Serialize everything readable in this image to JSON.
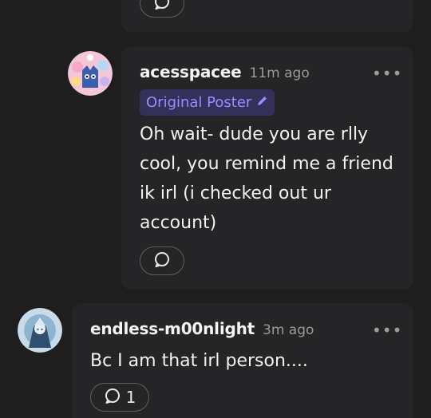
{
  "comments": [
    {
      "username": "acesspacee",
      "time": "11m ago",
      "badge": "Original Poster",
      "body": "Oh wait- dude you are rlly cool, you remind me a friend ik irl (i checked out ur account)",
      "more": "•••"
    },
    {
      "username": "endless-m00nlight",
      "time": "3m ago",
      "body": "Bc I am that irl person....",
      "more": "•••",
      "reply_count": "1"
    }
  ],
  "icons": {
    "reply": "speech-bubble-icon",
    "more": "more-options-icon",
    "pencil": "pencil-icon"
  },
  "colors": {
    "background": "#1e1e1f",
    "card": "#252527",
    "badge_bg": "#33305a",
    "badge_text": "#9b8cff",
    "muted": "#9b9b9b"
  }
}
